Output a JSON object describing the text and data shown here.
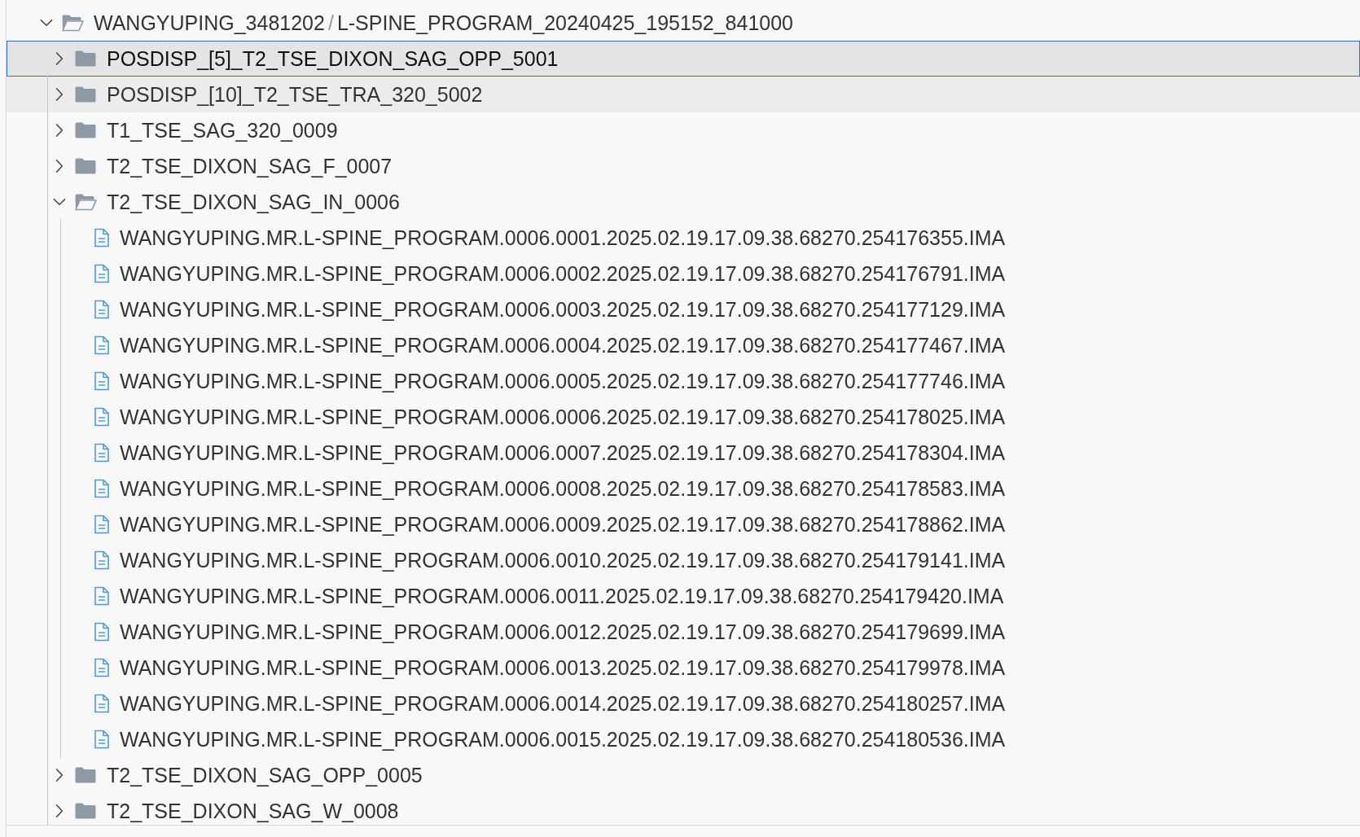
{
  "tree": {
    "root": {
      "name_parts": [
        "WANGYUPING_3481202",
        "L-SPINE_PROGRAM_20240425_195152_841000"
      ],
      "separator": "/",
      "kind": "folder",
      "expanded": true,
      "selected": false,
      "hovered": false,
      "children": [
        {
          "name": "POSDISP_[5]_T2_TSE_DIXON_SAG_OPP_5001",
          "kind": "folder",
          "expanded": false,
          "selected": true,
          "hovered": false
        },
        {
          "name": "POSDISP_[10]_T2_TSE_TRA_320_5002",
          "kind": "folder",
          "expanded": false,
          "selected": false,
          "hovered": true
        },
        {
          "name": "T1_TSE_SAG_320_0009",
          "kind": "folder",
          "expanded": false,
          "selected": false,
          "hovered": false
        },
        {
          "name": "T2_TSE_DIXON_SAG_F_0007",
          "kind": "folder",
          "expanded": false,
          "selected": false,
          "hovered": false
        },
        {
          "name": "T2_TSE_DIXON_SAG_IN_0006",
          "kind": "folder",
          "expanded": true,
          "selected": false,
          "hovered": false,
          "children": [
            {
              "name": "WANGYUPING.MR.L-SPINE_PROGRAM.0006.0001.2025.02.19.17.09.38.68270.254176355.IMA",
              "kind": "file",
              "selected": false,
              "hovered": false
            },
            {
              "name": "WANGYUPING.MR.L-SPINE_PROGRAM.0006.0002.2025.02.19.17.09.38.68270.254176791.IMA",
              "kind": "file",
              "selected": false,
              "hovered": false
            },
            {
              "name": "WANGYUPING.MR.L-SPINE_PROGRAM.0006.0003.2025.02.19.17.09.38.68270.254177129.IMA",
              "kind": "file",
              "selected": false,
              "hovered": false
            },
            {
              "name": "WANGYUPING.MR.L-SPINE_PROGRAM.0006.0004.2025.02.19.17.09.38.68270.254177467.IMA",
              "kind": "file",
              "selected": false,
              "hovered": false
            },
            {
              "name": "WANGYUPING.MR.L-SPINE_PROGRAM.0006.0005.2025.02.19.17.09.38.68270.254177746.IMA",
              "kind": "file",
              "selected": false,
              "hovered": false
            },
            {
              "name": "WANGYUPING.MR.L-SPINE_PROGRAM.0006.0006.2025.02.19.17.09.38.68270.254178025.IMA",
              "kind": "file",
              "selected": false,
              "hovered": false
            },
            {
              "name": "WANGYUPING.MR.L-SPINE_PROGRAM.0006.0007.2025.02.19.17.09.38.68270.254178304.IMA",
              "kind": "file",
              "selected": false,
              "hovered": false
            },
            {
              "name": "WANGYUPING.MR.L-SPINE_PROGRAM.0006.0008.2025.02.19.17.09.38.68270.254178583.IMA",
              "kind": "file",
              "selected": false,
              "hovered": false
            },
            {
              "name": "WANGYUPING.MR.L-SPINE_PROGRAM.0006.0009.2025.02.19.17.09.38.68270.254178862.IMA",
              "kind": "file",
              "selected": false,
              "hovered": false
            },
            {
              "name": "WANGYUPING.MR.L-SPINE_PROGRAM.0006.0010.2025.02.19.17.09.38.68270.254179141.IMA",
              "kind": "file",
              "selected": false,
              "hovered": false
            },
            {
              "name": "WANGYUPING.MR.L-SPINE_PROGRAM.0006.0011.2025.02.19.17.09.38.68270.254179420.IMA",
              "kind": "file",
              "selected": false,
              "hovered": false
            },
            {
              "name": "WANGYUPING.MR.L-SPINE_PROGRAM.0006.0012.2025.02.19.17.09.38.68270.254179699.IMA",
              "kind": "file",
              "selected": false,
              "hovered": false
            },
            {
              "name": "WANGYUPING.MR.L-SPINE_PROGRAM.0006.0013.2025.02.19.17.09.38.68270.254179978.IMA",
              "kind": "file",
              "selected": false,
              "hovered": false
            },
            {
              "name": "WANGYUPING.MR.L-SPINE_PROGRAM.0006.0014.2025.02.19.17.09.38.68270.254180257.IMA",
              "kind": "file",
              "selected": false,
              "hovered": false
            },
            {
              "name": "WANGYUPING.MR.L-SPINE_PROGRAM.0006.0015.2025.02.19.17.09.38.68270.254180536.IMA",
              "kind": "file",
              "selected": false,
              "hovered": false
            }
          ]
        },
        {
          "name": "T2_TSE_DIXON_SAG_OPP_0005",
          "kind": "folder",
          "expanded": false,
          "selected": false,
          "hovered": false
        },
        {
          "name": "T2_TSE_DIXON_SAG_W_0008",
          "kind": "folder",
          "expanded": false,
          "selected": false,
          "hovered": false
        }
      ]
    }
  }
}
